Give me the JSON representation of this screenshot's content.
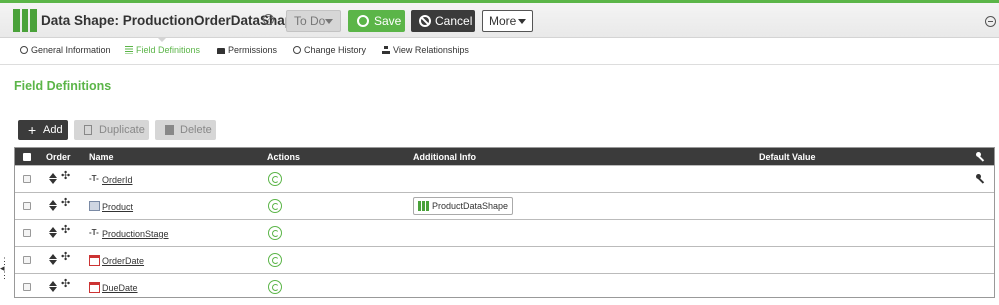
{
  "header": {
    "title": "Data Shape: ProductionOrderDataShape",
    "help_label": "?",
    "todo_label": "To Do",
    "save_label": "Save",
    "cancel_label": "Cancel",
    "more_label": "More"
  },
  "tabs": [
    {
      "label": "General Information",
      "icon": "info-icon"
    },
    {
      "label": "Field Definitions",
      "icon": "list-icon"
    },
    {
      "label": "Permissions",
      "icon": "lock-icon"
    },
    {
      "label": "Change History",
      "icon": "clock-icon"
    },
    {
      "label": "View Relationships",
      "icon": "tree-icon"
    }
  ],
  "section": {
    "title": "Field Definitions"
  },
  "toolbar": {
    "add_label": "Add",
    "duplicate_label": "Duplicate",
    "delete_label": "Delete"
  },
  "table": {
    "columns": [
      "Order",
      "Name",
      "Actions",
      "Additional Info",
      "Default Value"
    ],
    "rows": [
      {
        "name": "OrderId",
        "type_icon": "string-type-icon",
        "additional_info": "",
        "has_key": true
      },
      {
        "name": "Product",
        "type_icon": "datashape-type-icon",
        "additional_info": "ProductDataShape",
        "has_key": false
      },
      {
        "name": "ProductionStage",
        "type_icon": "string-type-icon",
        "additional_info": "",
        "has_key": false
      },
      {
        "name": "OrderDate",
        "type_icon": "date-type-icon",
        "additional_info": "",
        "has_key": false
      },
      {
        "name": "DueDate",
        "type_icon": "date-type-icon",
        "additional_info": "",
        "has_key": false
      }
    ]
  },
  "colors": {
    "accent": "#5bb548",
    "dark": "#3b3b3b"
  }
}
